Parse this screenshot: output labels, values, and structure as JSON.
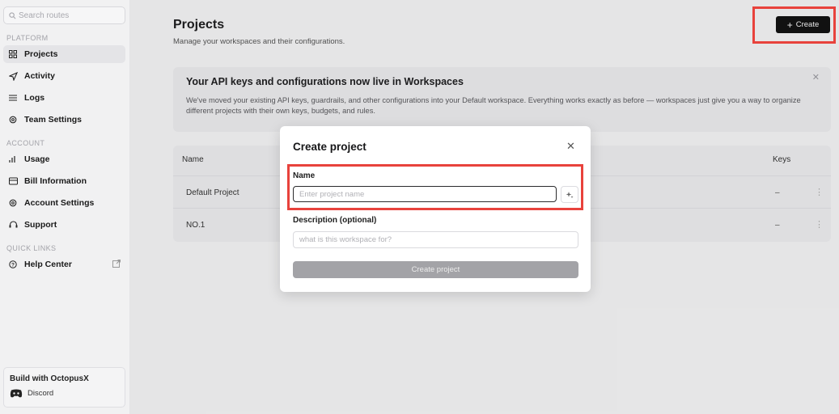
{
  "sidebar": {
    "search_placeholder": "Search routes",
    "platform_label": "PLATFORM",
    "platform_items": [
      {
        "label": "Projects",
        "icon": "grid-icon"
      },
      {
        "label": "Activity",
        "icon": "send-icon"
      },
      {
        "label": "Logs",
        "icon": "list-icon"
      },
      {
        "label": "Team Settings",
        "icon": "gear-icon"
      }
    ],
    "account_label": "ACCOUNT",
    "account_items": [
      {
        "label": "Usage",
        "icon": "bar-chart-icon"
      },
      {
        "label": "Bill Information",
        "icon": "receipt-icon"
      },
      {
        "label": "Account Settings",
        "icon": "gear-icon"
      },
      {
        "label": "Support",
        "icon": "support-icon"
      }
    ],
    "quick_links_label": "QUICK LINKS",
    "quick_links": [
      {
        "label": "Help Center",
        "icon": "help-icon"
      }
    ],
    "build": {
      "title": "Build with OctopusX",
      "discord": "Discord"
    }
  },
  "header": {
    "title": "Projects",
    "subtitle": "Manage your workspaces and their configurations.",
    "create_label": "Create"
  },
  "banner": {
    "title": "Your API keys and configurations now live in Workspaces",
    "body": "We've moved your existing API keys, guardrails, and other configurations into your Default workspace. Everything works exactly as before — workspaces just give you a way to organize different projects with their own keys, budgets, and rules."
  },
  "table": {
    "columns": [
      "Name",
      "Keys"
    ],
    "rows": [
      {
        "name": "Default Project",
        "keys": "–"
      },
      {
        "name": "NO.1",
        "keys": "–"
      }
    ]
  },
  "modal": {
    "title": "Create project",
    "name_label": "Name",
    "name_placeholder": "Enter project name",
    "desc_label": "Description (optional)",
    "desc_placeholder": "what is this workspace for?",
    "submit_label": "Create project"
  },
  "colors": {
    "highlight": "#e8423c",
    "primary_button": "#111111",
    "disabled_button": "#a3a3a7"
  }
}
